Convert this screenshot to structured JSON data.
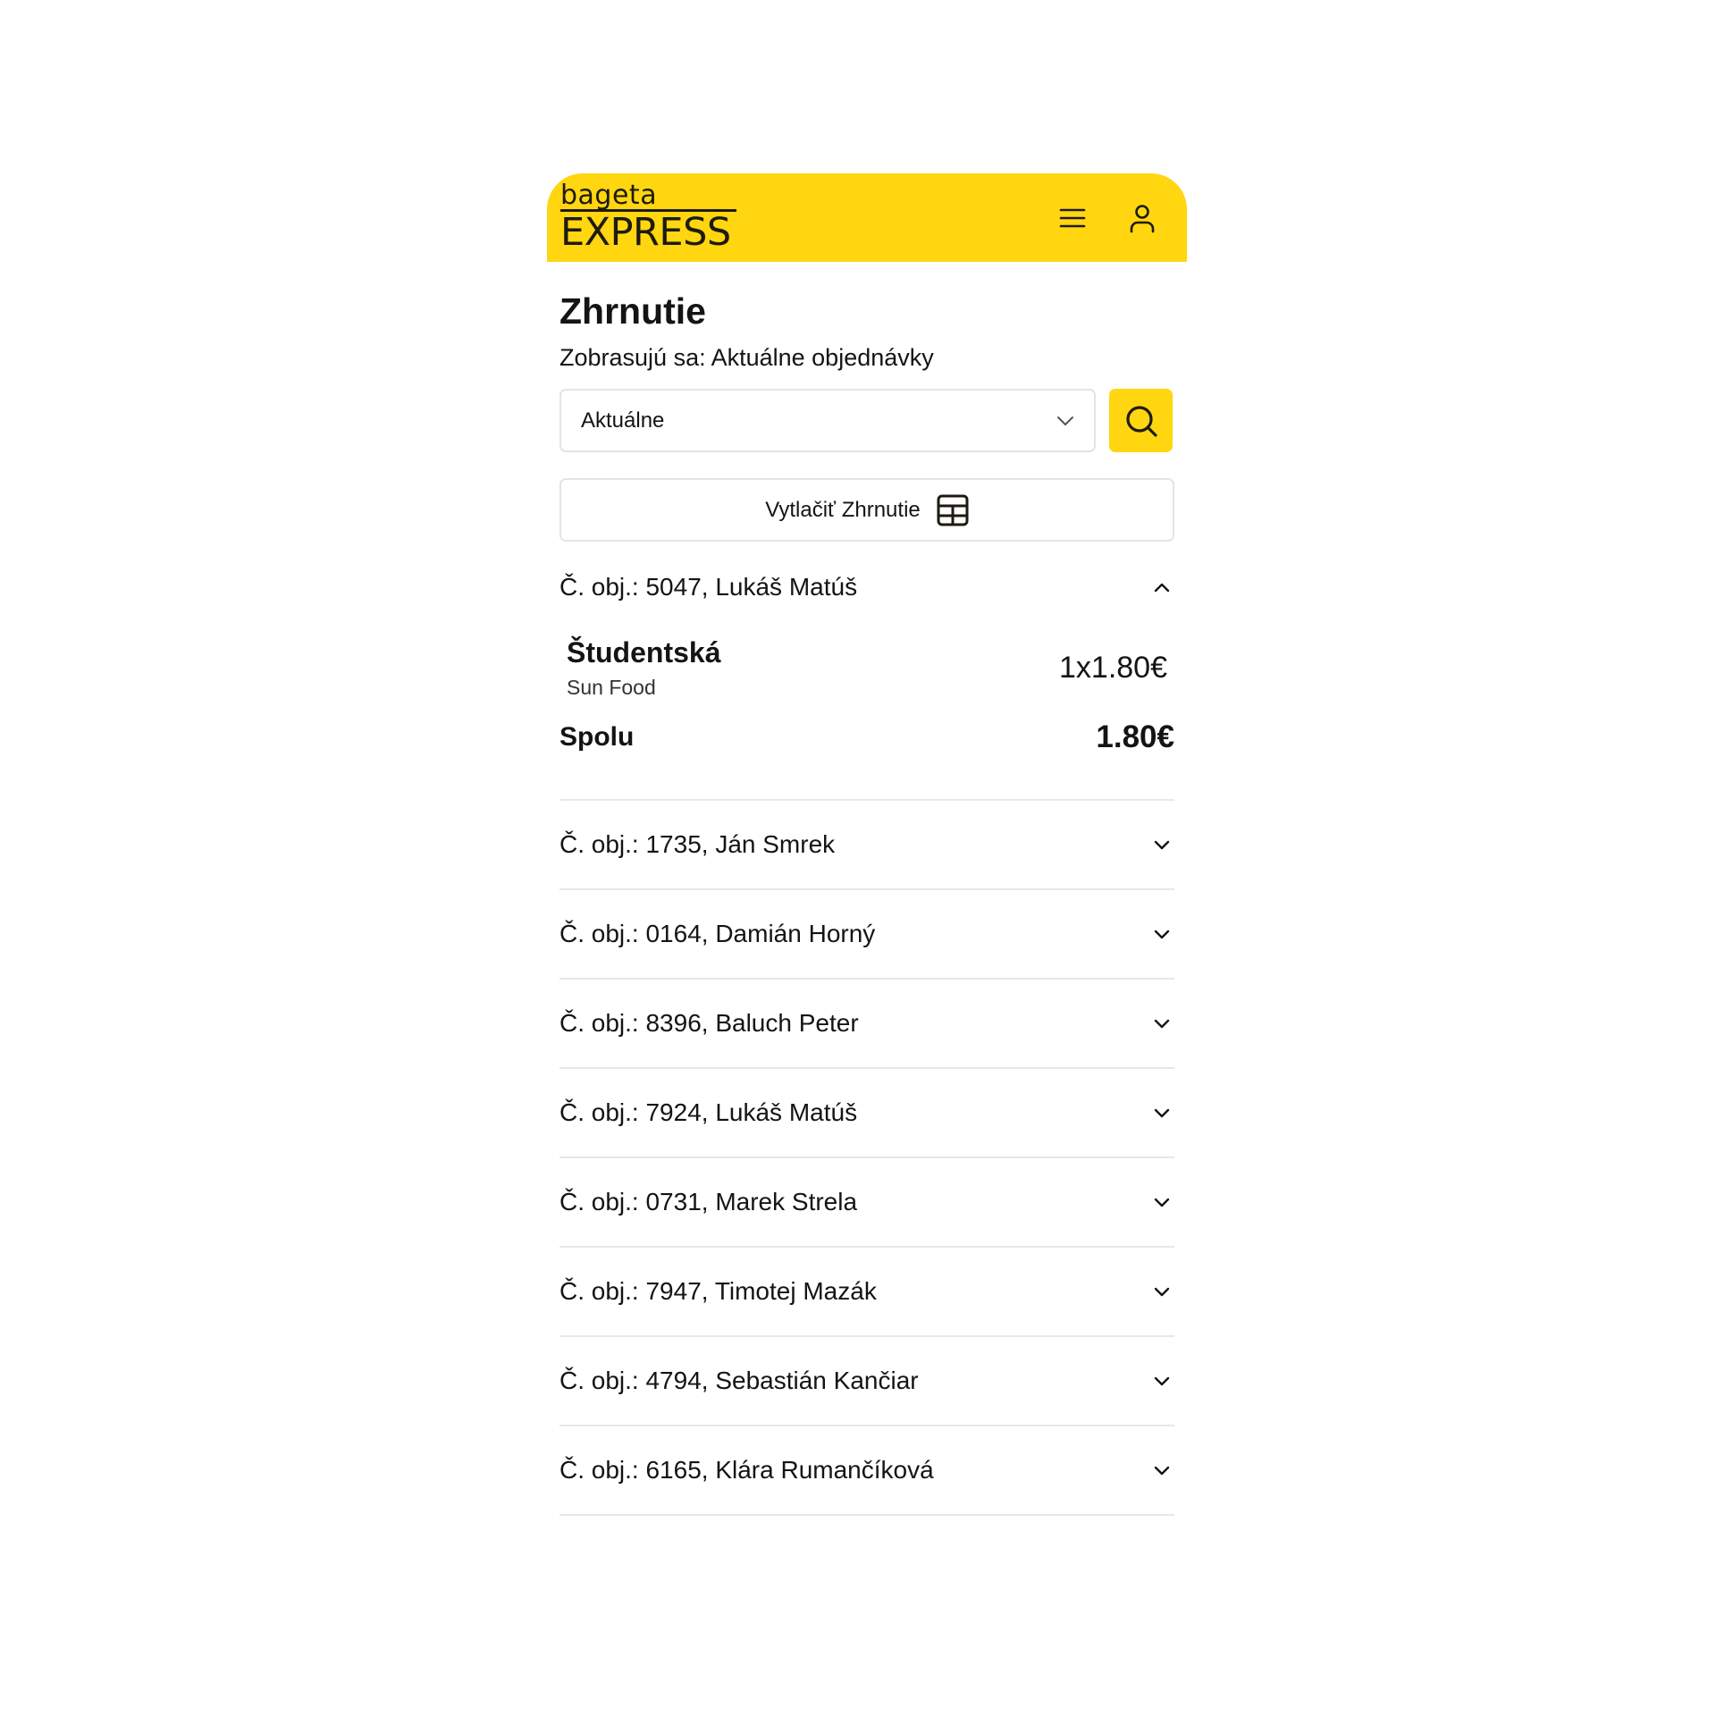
{
  "header": {
    "logo_small": "bageta",
    "logo_big": "EXPRESS",
    "accent_color": "#FFD60F",
    "icons": [
      "menu-icon",
      "user-icon"
    ]
  },
  "page": {
    "title": "Zhrnutie",
    "subtitle": "Zobrasujú sa: Aktuálne objednávky"
  },
  "filter": {
    "selected": "Aktuálne",
    "search_icon": "search-icon"
  },
  "print_button": {
    "label": "Vytlačiť Zhrnutie",
    "icon": "table-icon"
  },
  "expanded_order": {
    "label": "Č. obj.: 5047, Lukáš Matúš",
    "items": [
      {
        "name": "Študentská",
        "shop": "Sun Food",
        "price": "1x1.80€"
      }
    ],
    "total_label": "Spolu",
    "total_value": "1.80€"
  },
  "orders": [
    {
      "label": "Č. obj.: 1735, Ján Smrek"
    },
    {
      "label": "Č. obj.: 0164, Damián Horný"
    },
    {
      "label": "Č. obj.: 8396, Baluch Peter"
    },
    {
      "label": "Č. obj.: 7924, Lukáš Matúš"
    },
    {
      "label": "Č. obj.: 0731, Marek Strela"
    },
    {
      "label": "Č. obj.: 7947, Timotej Mazák"
    },
    {
      "label": "Č. obj.: 4794, Sebastián Kančiar"
    },
    {
      "label": "Č. obj.: 6165, Klára Rumančíková"
    }
  ]
}
